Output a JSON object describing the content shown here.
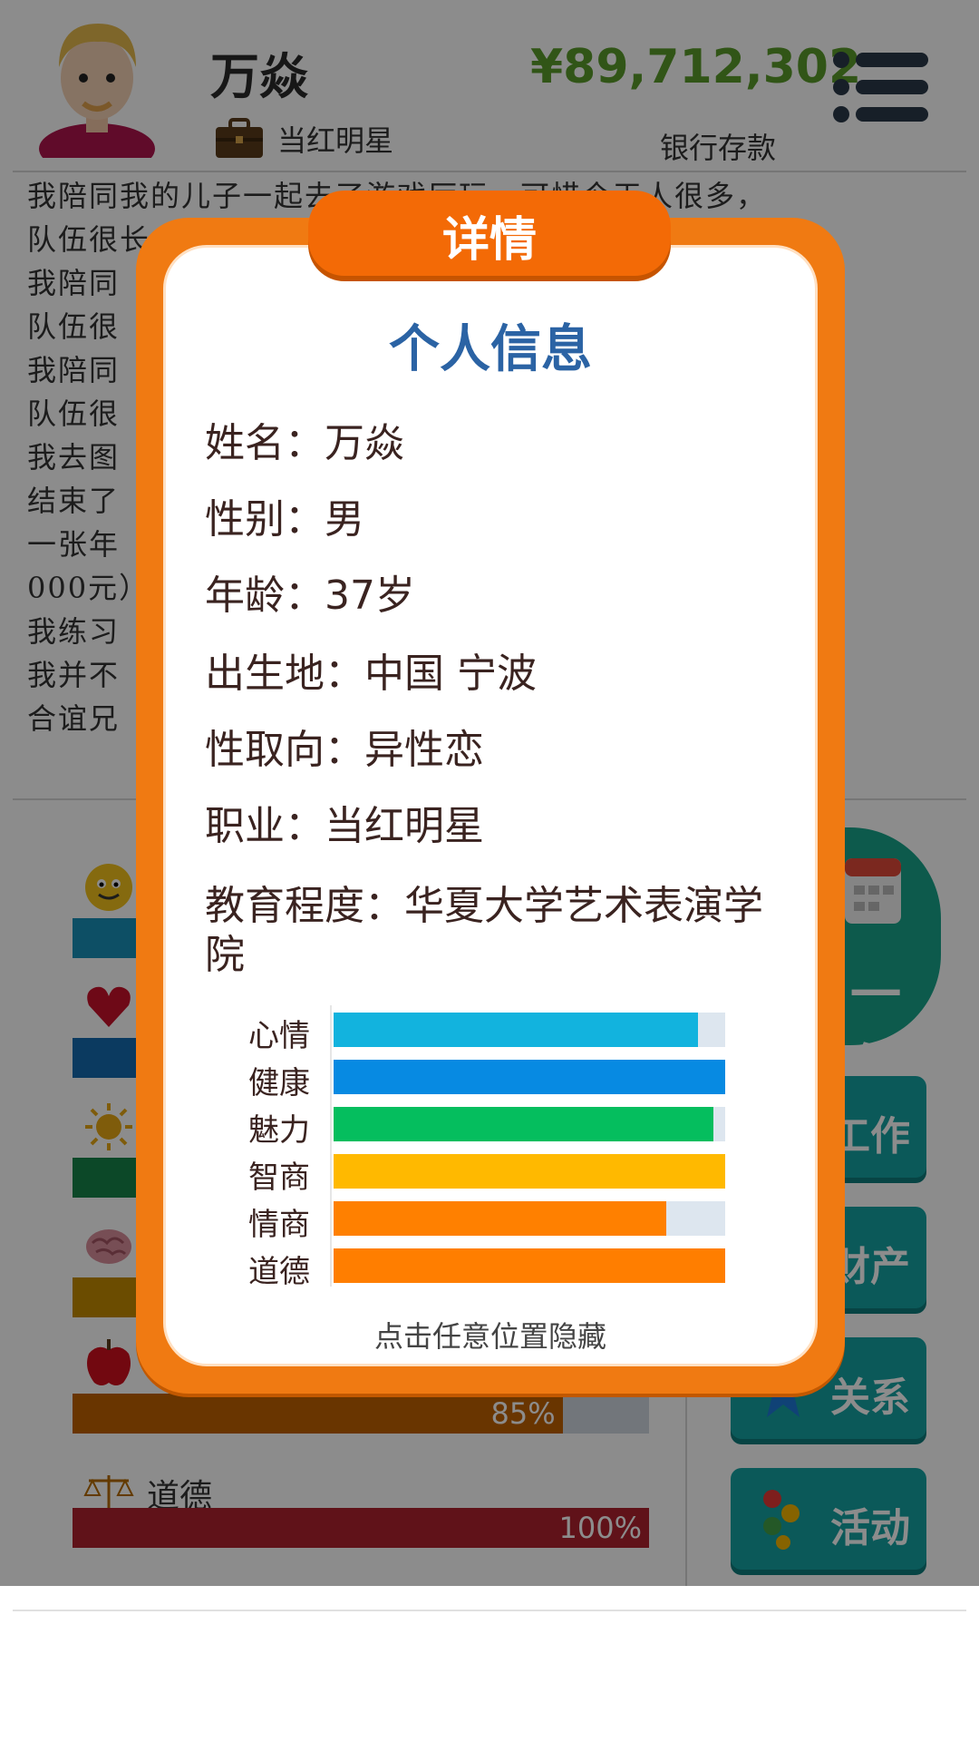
{
  "header": {
    "name": "万焱",
    "job": "当红明星",
    "money": "¥89,712,302",
    "bank_label": "银行存款"
  },
  "log_lines": [
    "我陪同我的儿子一起去了游戏厅玩，可惜今天人很多，",
    "队伍很长，没能",
    "我陪同",
    "队伍很",
    "我陪同",
    "队伍很",
    "我去图",
    "结束了",
    "一张年",
    "000元）",
    "我练习",
    "我并不",
    "合谊兄"
  ],
  "stats_panel": {
    "items": [
      {
        "name": "心情",
        "value": "",
        "color": "#1891b8"
      },
      {
        "name": "健康",
        "value": "",
        "color": "#156bb0"
      },
      {
        "name": "魅力",
        "value": "",
        "color": "#17834a"
      },
      {
        "name": "智商",
        "value": "",
        "color": "#c48a00"
      },
      {
        "name": "情商",
        "value": "85%",
        "color": "#c06100"
      },
      {
        "name": "道德",
        "value": "100%",
        "color": "#b0212e"
      }
    ]
  },
  "side_buttons": {
    "next_year": "一年",
    "work": "工作",
    "assets": "财产",
    "relations": "关系",
    "activities": "活动"
  },
  "modal": {
    "tab_title": "详情",
    "section_title": "个人信息",
    "info": [
      {
        "label": "姓名：",
        "value": "万焱"
      },
      {
        "label": "性别：",
        "value": "男"
      },
      {
        "label": "年龄：",
        "value": "37岁"
      },
      {
        "label": "出生地：",
        "value": "中国 宁波"
      },
      {
        "label": "性取向：",
        "value": "异性恋"
      },
      {
        "label": "职业：",
        "value": "当红明星"
      },
      {
        "label": "教育程度：",
        "value": "华夏大学艺术表演学院"
      }
    ],
    "attributes": [
      {
        "name": "心情",
        "level": 0.93,
        "color": "#12b3de"
      },
      {
        "name": "健康",
        "level": 1.0,
        "color": "#078ae2"
      },
      {
        "name": "魅力",
        "level": 0.97,
        "color": "#05be5e"
      },
      {
        "name": "智商",
        "level": 1.0,
        "color": "#ffb900"
      },
      {
        "name": "情商",
        "level": 0.85,
        "color": "#ff8000"
      },
      {
        "name": "道德",
        "level": 1.0,
        "color": "#ff7e00"
      }
    ],
    "hint": "点击任意位置隐藏"
  },
  "colors": {
    "modal_orange": "#f07a12",
    "title_blue": "#2b63a4",
    "money_green": "#5a9c2a",
    "button_teal": "#14a3a3"
  }
}
